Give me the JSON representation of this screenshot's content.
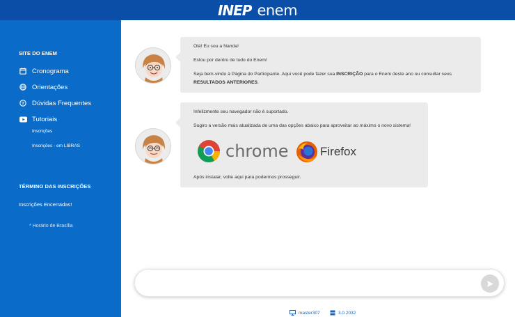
{
  "header": {
    "brand_inep": "INEP",
    "brand_enem": "enem"
  },
  "sidebar": {
    "heading": "SITE DO ENEM",
    "items": [
      {
        "label": "Cronograma",
        "icon": "calendar-icon"
      },
      {
        "label": "Orientações",
        "icon": "globe-icon"
      },
      {
        "label": "Dúvidas Frequentes",
        "icon": "question-icon"
      },
      {
        "label": "Tutoriais",
        "icon": "youtube-icon"
      }
    ],
    "subitems": [
      "Inscrições",
      "Inscrições - em LIBRAS"
    ],
    "termino_heading": "TÉRMINO DAS INSCRIÇÕES",
    "termino_status": "Inscrições Encerradas!",
    "note": "* Horário de Brasília"
  },
  "chat": {
    "message1": {
      "line1": "Olá! Eu sou a Nanda!",
      "line2": "Estou por dentro de tudo do Enem!",
      "line3_pre": "Seja bem-vindo à Página do Participante. Aqui você pode fazer sua ",
      "line3_bold": "INSCRIÇÃO",
      "line3_post": " para o Enem deste ano ou consultar seus",
      "line4_bold": "RESULTADOS ANTERIORES",
      "line4_post": "."
    },
    "message2": {
      "line1": "Infelizmente seu navegador não é suportado.",
      "line2": "Sugiro a versão mais atualizada de uma das opções abaixo para aproveitar ao máximo o novo sistema!",
      "chrome_label": "chrome",
      "firefox_label": "Firefox",
      "line3": "Após instalar, volte aqui para podermos prosseguir."
    },
    "input_value": ""
  },
  "footer": {
    "machine": "master307",
    "version": "3.0.2032"
  },
  "colors": {
    "topbar": "#0a4ea7",
    "sidebar": "#0b6bc8",
    "bubble": "#ebebeb",
    "footer_link": "#1a63b8"
  }
}
